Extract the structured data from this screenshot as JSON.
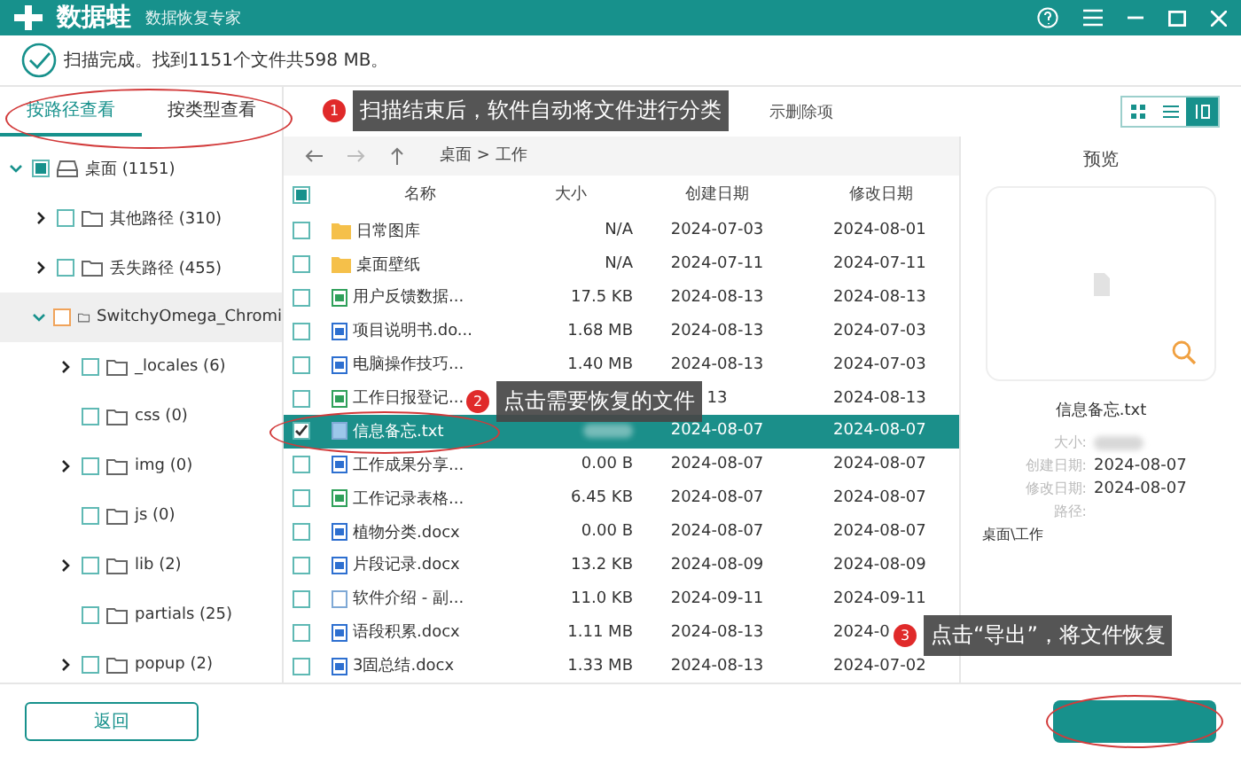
{
  "window": {
    "app_name": "数据蛙",
    "subtitle": "数据恢复专家"
  },
  "status": {
    "text": "扫描完成。找到1151个文件共598 MB。"
  },
  "view_tabs": [
    {
      "label": "按路径查看",
      "selected": true
    },
    {
      "label": "按类型查看",
      "selected": false
    }
  ],
  "tree": [
    {
      "label": "桌面 (1151)",
      "kind": "drive",
      "checked": true,
      "expanded": true,
      "expandable": true,
      "children": [
        {
          "label": "其他路径 (310)",
          "kind": "folder",
          "checked": false,
          "expanded": false,
          "expandable": true
        },
        {
          "label": "丢失路径 (455)",
          "kind": "folder",
          "checked": false,
          "expanded": false,
          "expandable": true
        },
        {
          "label": "SwitchyOmega_Chromi",
          "kind": "folder",
          "checked": false,
          "expanded": true,
          "expandable": true,
          "selected": true,
          "children": [
            {
              "label": "_locales (6)",
              "kind": "folder",
              "checked": false,
              "expanded": false,
              "expandable": true
            },
            {
              "label": "css (0)",
              "kind": "folder",
              "checked": false,
              "expanded": false,
              "expandable": false
            },
            {
              "label": "img (0)",
              "kind": "folder",
              "checked": false,
              "expanded": false,
              "expandable": true
            },
            {
              "label": "js (0)",
              "kind": "folder",
              "checked": false,
              "expanded": false,
              "expandable": false
            },
            {
              "label": "lib (2)",
              "kind": "folder",
              "checked": false,
              "expanded": false,
              "expandable": true
            },
            {
              "label": "partials (25)",
              "kind": "folder",
              "checked": false,
              "expanded": false,
              "expandable": false
            },
            {
              "label": "popup (2)",
              "kind": "folder",
              "checked": false,
              "expanded": false,
              "expandable": true
            }
          ]
        }
      ]
    }
  ],
  "toolbar": {
    "show_deleted_label": "示删除项",
    "views": [
      {
        "kind": "grid",
        "selected": false
      },
      {
        "kind": "list",
        "selected": false
      },
      {
        "kind": "detail",
        "selected": true
      }
    ]
  },
  "breadcrumb": "桌面 > 工作",
  "table": {
    "all_checked": true,
    "columns": [
      "名称",
      "大小",
      "创建日期",
      "修改日期"
    ],
    "rows": [
      {
        "kind": "folder",
        "name": "日常图库",
        "size": "N/A",
        "created": "2024-07-03",
        "modified": "2024-08-01",
        "checked": false,
        "selected": false
      },
      {
        "kind": "folder",
        "name": "桌面壁纸",
        "size": "N/A",
        "created": "2024-07-11",
        "modified": "2024-07-11",
        "checked": false,
        "selected": false
      },
      {
        "kind": "sheet",
        "name": "用户反馈数据...",
        "size": "17.5 KB",
        "created": "2024-08-13",
        "modified": "2024-08-13",
        "checked": false,
        "selected": false
      },
      {
        "kind": "doc",
        "name": "项目说明书.do...",
        "size": "1.68 MB",
        "created": "2024-08-13",
        "modified": "2024-07-03",
        "checked": false,
        "selected": false
      },
      {
        "kind": "doc",
        "name": "电脑操作技巧...",
        "size": "1.40 MB",
        "created": "2024-08-13",
        "modified": "2024-07-03",
        "checked": false,
        "selected": false
      },
      {
        "kind": "sheet",
        "name": "工作日报登记...",
        "created": "13",
        "modified": "2024-08-13",
        "checked": false,
        "selected": false
      },
      {
        "kind": "txt",
        "name": "信息备忘.txt",
        "size_blurred": true,
        "created": "2024-08-07",
        "modified": "2024-08-07",
        "checked": true,
        "selected": true
      },
      {
        "kind": "doc",
        "name": "工作成果分享...",
        "size": "0.00  B",
        "created": "2024-08-07",
        "modified": "2024-08-07",
        "checked": false,
        "selected": false
      },
      {
        "kind": "sheet",
        "name": "工作记录表格...",
        "size": "6.45 KB",
        "created": "2024-08-07",
        "modified": "2024-08-07",
        "checked": false,
        "selected": false
      },
      {
        "kind": "doc",
        "name": "植物分类.docx",
        "size": "0.00  B",
        "created": "2024-08-07",
        "modified": "2024-08-07",
        "checked": false,
        "selected": false
      },
      {
        "kind": "doc",
        "name": "片段记录.docx",
        "size": "13.2 KB",
        "created": "2024-08-09",
        "modified": "2024-08-09",
        "checked": false,
        "selected": false
      },
      {
        "kind": "txt",
        "name": "软件介绍 - 副...",
        "size": "11.0 KB",
        "created": "2024-09-11",
        "modified": "2024-09-11",
        "checked": false,
        "selected": false
      },
      {
        "kind": "doc",
        "name": "语段积累.docx",
        "size": "1.11 MB",
        "created": "2024-08-13",
        "modified": "2024-0",
        "checked": false,
        "selected": false
      },
      {
        "kind": "doc",
        "name": "3固总结.docx",
        "size": "1.33 MB",
        "created": "2024-08-13",
        "modified": "2024-07-02",
        "checked": false,
        "selected": false
      }
    ]
  },
  "preview": {
    "title": "预览",
    "file_name": "信息备忘.txt",
    "fields": [
      {
        "label": "大小:"
      },
      {
        "label": "创建日期:",
        "value": "2024-08-07"
      },
      {
        "label": "修改日期:",
        "value": "2024-08-07"
      },
      {
        "label": "路径:"
      }
    ],
    "path": "桌面\\工作"
  },
  "footer": {
    "back_button": "返回"
  },
  "callouts": [
    {
      "number": "1",
      "text": "扫描结束后，软件自动将文件进行分类"
    },
    {
      "number": "2",
      "text": "点击需要恢复的文件"
    },
    {
      "number": "3",
      "text": "点击“导出”，将文件恢复"
    }
  ]
}
